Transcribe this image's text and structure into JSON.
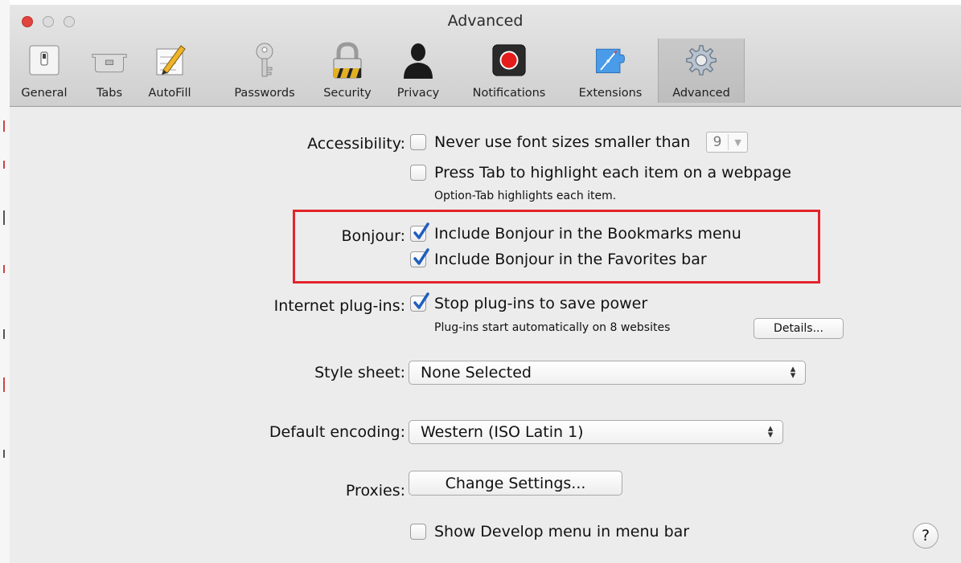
{
  "window": {
    "title": "Advanced"
  },
  "toolbar": {
    "items": [
      {
        "label": "General",
        "icon": "switch-icon"
      },
      {
        "label": "Tabs",
        "icon": "tabs-icon"
      },
      {
        "label": "AutoFill",
        "icon": "pencil-form-icon"
      },
      {
        "label": "Passwords",
        "icon": "key-icon"
      },
      {
        "label": "Security",
        "icon": "padlock-icon"
      },
      {
        "label": "Privacy",
        "icon": "person-silhouette-icon"
      },
      {
        "label": "Notifications",
        "icon": "notification-icon"
      },
      {
        "label": "Extensions",
        "icon": "compass-puzzle-icon"
      },
      {
        "label": "Advanced",
        "icon": "gear-icon",
        "selected": true
      }
    ]
  },
  "accessibility": {
    "label": "Accessibility:",
    "min_font_label": "Never use font sizes smaller than",
    "min_font_checked": false,
    "min_font_value": "9",
    "press_tab_label": "Press Tab to highlight each item on a webpage",
    "press_tab_checked": false,
    "hint": "Option-Tab highlights each item."
  },
  "bonjour": {
    "label": "Bonjour:",
    "bookmarks_label": "Include Bonjour in the Bookmarks menu",
    "bookmarks_checked": true,
    "favorites_label": "Include Bonjour in the Favorites bar",
    "favorites_checked": true
  },
  "plugins": {
    "label": "Internet plug-ins:",
    "stop_label": "Stop plug-ins to save power",
    "stop_checked": true,
    "hint": "Plug-ins start automatically on 8 websites",
    "details_button": "Details..."
  },
  "style_sheet": {
    "label": "Style sheet:",
    "value": "None Selected"
  },
  "encoding": {
    "label": "Default encoding:",
    "value": "Western (ISO Latin 1)"
  },
  "proxies": {
    "label": "Proxies:",
    "button": "Change Settings..."
  },
  "develop": {
    "label": "Show Develop menu in menu bar",
    "checked": false
  },
  "help": {
    "glyph": "?"
  },
  "colors": {
    "highlight": "#e3242b",
    "checkmark": "#1f5fbf",
    "close": "#e0443e"
  }
}
